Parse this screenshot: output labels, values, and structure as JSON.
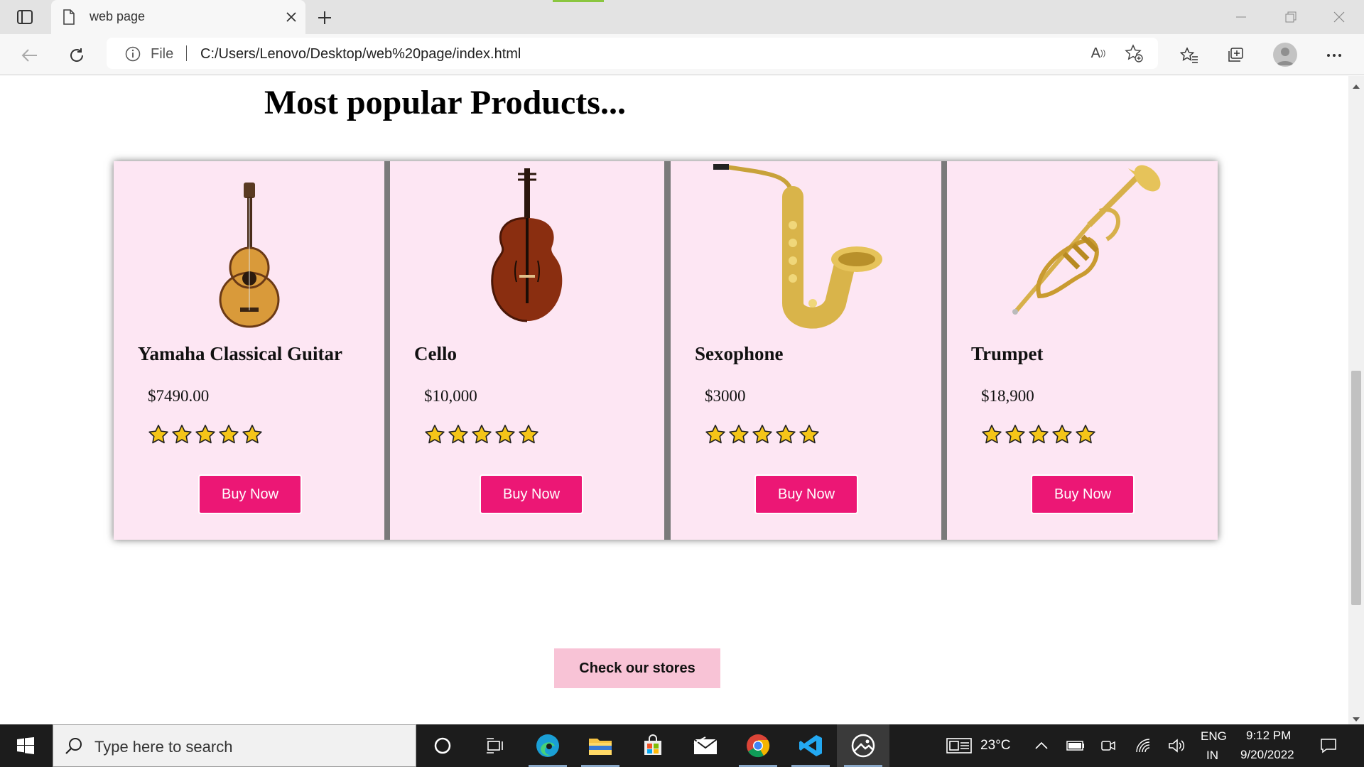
{
  "browser": {
    "tab_title": "web page",
    "address_scheme": "File",
    "url": "C:/Users/Lenovo/Desktop/web%20page/index.html"
  },
  "page": {
    "heading": "Most popular Products...",
    "products": [
      {
        "name": "Yamaha Classical Guitar",
        "price": "$7490.00",
        "rating": 5,
        "button": "Buy Now",
        "icon": "guitar-image"
      },
      {
        "name": "Cello",
        "price": "$10,000",
        "rating": 5,
        "button": "Buy Now",
        "icon": "cello-image"
      },
      {
        "name": "Sexophone",
        "price": "$3000",
        "rating": 5,
        "button": "Buy Now",
        "icon": "saxophone-image"
      },
      {
        "name": "Trumpet",
        "price": "$18,900",
        "rating": 5,
        "button": "Buy Now",
        "icon": "trumpet-image"
      }
    ],
    "stores_button": "Check our stores",
    "card_bg": "#fde6f3",
    "buy_color": "#ec1775",
    "stores_color": "#f8c3d6"
  },
  "taskbar": {
    "search_placeholder": "Type here to search",
    "temperature": "23°C",
    "language": "ENG",
    "region": "IN",
    "time": "9:12 PM",
    "date": "9/20/2022"
  }
}
